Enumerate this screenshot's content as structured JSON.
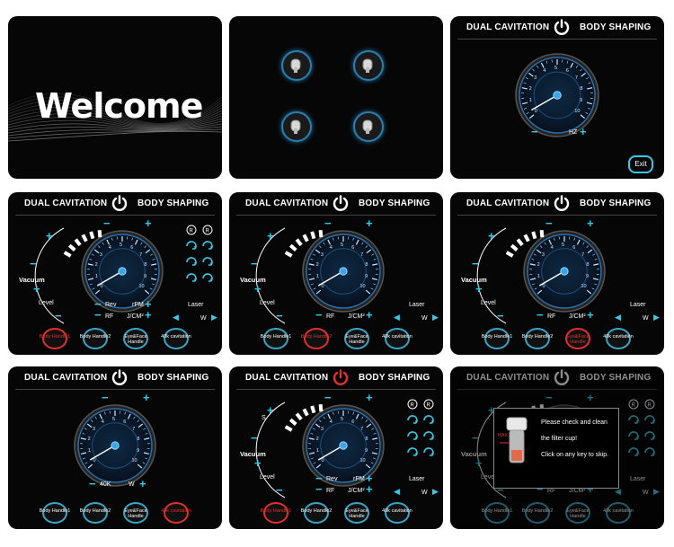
{
  "welcome": {
    "text": "Welcome"
  },
  "header": {
    "left": "DUAL CAVITATION",
    "right": "BODY SHAPING"
  },
  "single_gauge": {
    "minus_label": "−",
    "unit_label": "HZ",
    "plus_label": "+",
    "exit_label": "Exit"
  },
  "controls": {
    "vacuum_label": "Vacuum",
    "level_label": "Level",
    "rev_label": "Rev",
    "rpm_label": "rPM",
    "rf_label": "RF",
    "jcm_label": "J/CM²",
    "laser_label": "Laser",
    "w_label": "W",
    "s_label": "S",
    "k40_label": "40K",
    "plus": "+",
    "minus": "−"
  },
  "handles": [
    {
      "label": "Body Handle1"
    },
    {
      "label": "Body Handle2"
    },
    {
      "label": "Eye&Face Handle"
    },
    {
      "label": "40k cavitation"
    }
  ],
  "dialog": {
    "line1": "Please check and clean",
    "line2": "the filter cup!",
    "line3": "Click on any key to skip.",
    "max_label": "MAX"
  },
  "colors": {
    "accent": "#38c8e8",
    "active": "#e03030",
    "panel_bg": "#060606"
  },
  "gauge_ticks": [
    "0",
    "1",
    "2",
    "3",
    "4",
    "5",
    "6",
    "7",
    "8",
    "9",
    "10"
  ],
  "panels": [
    {
      "type": "welcome"
    },
    {
      "type": "handle-select"
    },
    {
      "type": "single-gauge"
    },
    {
      "type": "full",
      "active_handle": 0
    },
    {
      "type": "rf-laser",
      "active_handle": 1
    },
    {
      "type": "rf-laser",
      "active_handle": 2
    },
    {
      "type": "cavitation",
      "active_handle": 3
    },
    {
      "type": "full-s",
      "active_handle": 0
    },
    {
      "type": "dialog",
      "active_handle": -1
    }
  ]
}
